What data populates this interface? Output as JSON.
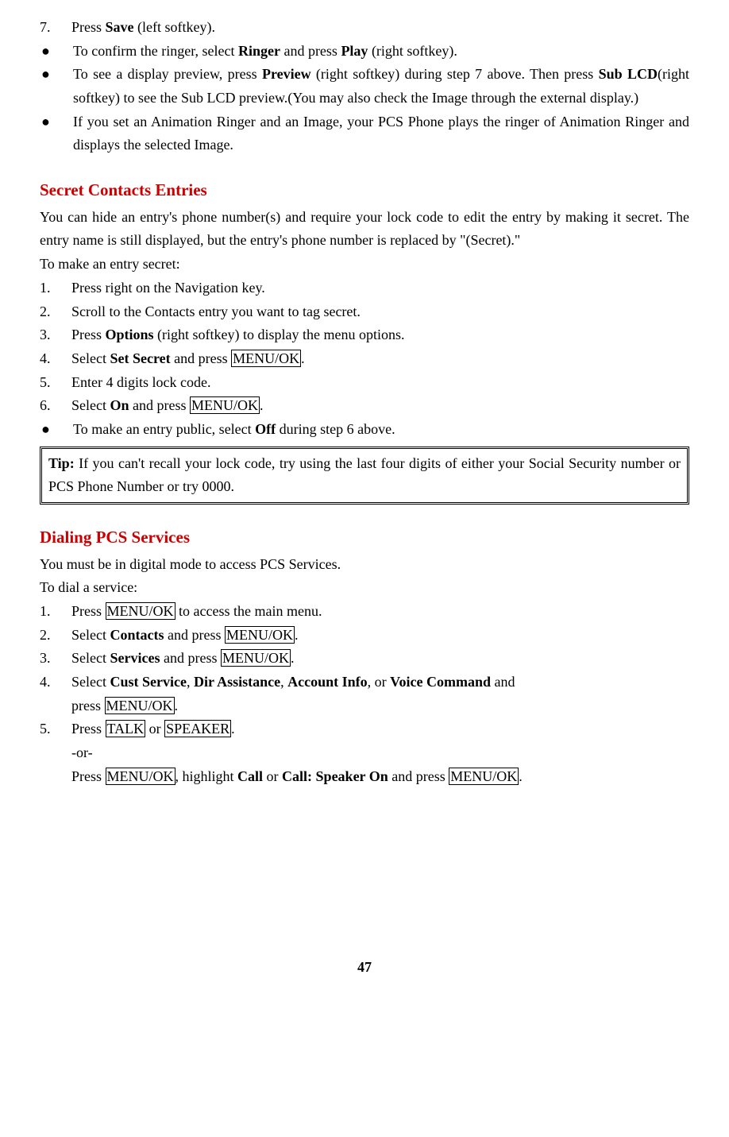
{
  "step7": {
    "num": "7.",
    "t1": "Press ",
    "save": "Save",
    "t2": " (left softkey)."
  },
  "bullets1": [
    {
      "t1": "To confirm the ringer, select ",
      "b1": "Ringer",
      "t2": " and press ",
      "b2": "Play",
      "t3": " (right softkey)."
    },
    {
      "t1": "To see a display preview, press ",
      "b1": "Preview",
      "t2": " (right softkey) during step 7 above. Then press ",
      "b2": "Sub LCD",
      "t3": "(right softkey) to see the Sub LCD preview.(You may also check the Image through the external display.)"
    },
    {
      "t1": "If you set an Animation Ringer and an Image, your PCS Phone plays the ringer of Animation Ringer and displays the selected Image."
    }
  ],
  "secret": {
    "heading": "Secret Contacts Entries",
    "intro": "You can hide an entry's phone number(s) and require your lock code to edit the entry by making it secret. The entry name is still displayed, but the entry's phone number is replaced by \"(Secret).\"",
    "lead": "To make an entry secret:",
    "steps": {
      "s1": {
        "num": "1.",
        "text": "Press right on the Navigation key."
      },
      "s2": {
        "num": "2.",
        "text": "Scroll to the Contacts entry you want to tag secret."
      },
      "s3": {
        "num": "3.",
        "t1": "Press ",
        "b1": "Options",
        "t2": " (right softkey) to display the menu options."
      },
      "s4": {
        "num": "4.",
        "t1": "Select ",
        "b1": "Set Secret",
        "t2": " and press ",
        "box1": "MENU/OK",
        "t3": "."
      },
      "s5": {
        "num": "5.",
        "text": "Enter 4 digits lock code."
      },
      "s6": {
        "num": "6.",
        "t1": "Select ",
        "b1": "On",
        "t2": " and press ",
        "box1": "MENU/OK",
        "t3": "."
      }
    },
    "bullet": {
      "t1": "To make an entry public, select ",
      "b1": "Off",
      "t2": " during step 6 above."
    }
  },
  "tip": {
    "label": "Tip:",
    "text": " If you can't recall your lock code, try using the last four digits of either your Social Security number or PCS Phone Number or try 0000."
  },
  "dialing": {
    "heading": "Dialing PCS Services",
    "intro": "You must be in digital mode to access PCS Services.",
    "lead": "To dial a service:",
    "s1": {
      "num": "1.",
      "t1": "Press ",
      "box1": "MENU/OK",
      "t2": " to access the main menu."
    },
    "s2": {
      "num": "2.",
      "t1": "Select ",
      "b1": "Contacts",
      "t2": " and press ",
      "box1": "MENU/OK",
      "t3": "."
    },
    "s3": {
      "num": "3.",
      "t1": "Select ",
      "b1": "Services",
      "t2": " and press ",
      "box1": "MENU/OK",
      "t3": "."
    },
    "s4": {
      "num": "4.",
      "t1": "Select ",
      "b1": "Cust Service",
      "t2": ", ",
      "b2": "Dir Assistance",
      "t3": ", ",
      "b3": "Account Info",
      "t4": ", or ",
      "b4": "Voice Command",
      "t5": " and",
      "line2_t1": "press ",
      "line2_box": "MENU/OK",
      "line2_t2": "."
    },
    "s5": {
      "num": "5.",
      "t1": "Press ",
      "box1": "TALK",
      "t2": " or ",
      "box2": "SPEAKER",
      "t3": ".",
      "or": "-or-",
      "line3_t1": "Press ",
      "line3_box1": "MENU/OK",
      "line3_t2": ", highlight ",
      "line3_b1": "Call",
      "line3_t3": " or ",
      "line3_b2": "Call: Speaker On",
      "line3_t4": " and press ",
      "line3_box2": "MENU/OK",
      "line3_t5": "."
    }
  },
  "pageNumber": "47"
}
